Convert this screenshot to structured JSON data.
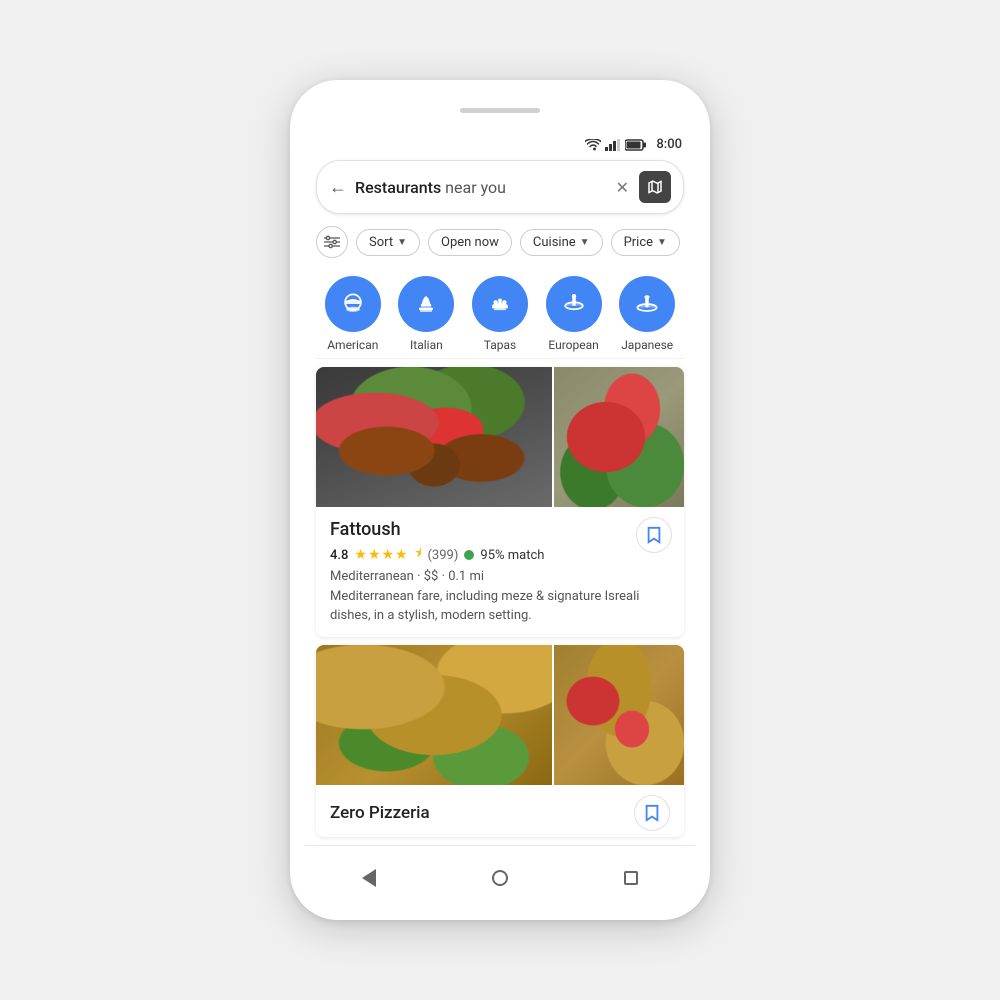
{
  "phone": {
    "status_bar": {
      "time": "8:00"
    },
    "search_bar": {
      "query_bold": "Restaurants",
      "query_rest": " near you",
      "clear_label": "×",
      "map_label": "map"
    },
    "filters": {
      "items": [
        {
          "label": "Sort",
          "has_arrow": true
        },
        {
          "label": "Open now",
          "has_arrow": false
        },
        {
          "label": "Cuisine",
          "has_arrow": true
        },
        {
          "label": "Price",
          "has_arrow": true
        }
      ]
    },
    "categories": [
      {
        "id": "american",
        "label": "American"
      },
      {
        "id": "italian",
        "label": "Italian"
      },
      {
        "id": "tapas",
        "label": "Tapas"
      },
      {
        "id": "european",
        "label": "European"
      },
      {
        "id": "japanese",
        "label": "Japanese"
      }
    ],
    "restaurant_1": {
      "name": "Fattoush",
      "rating": "4.8",
      "review_count": "(399)",
      "match": "95% match",
      "cuisine": "Mediterranean",
      "price": "$$",
      "distance": "0.1 mi",
      "description": "Mediterranean fare, including meze & signature Isreali dishes, in a stylish, modern setting."
    },
    "restaurant_2": {
      "name": "Zero Pizzeria"
    },
    "nav": {
      "back": "back",
      "home": "home",
      "recent": "recent"
    }
  }
}
